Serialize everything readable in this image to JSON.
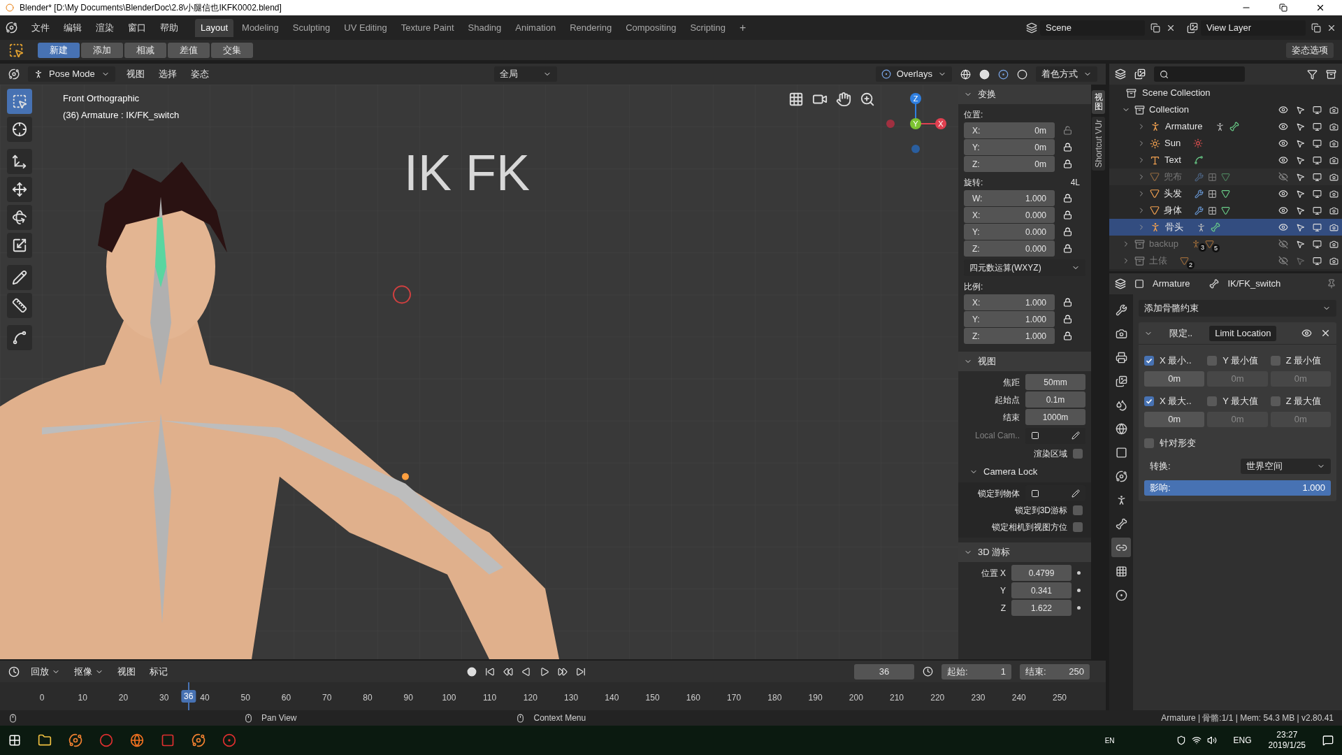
{
  "window": {
    "title": "Blender* [D:\\My Documents\\BlenderDoc\\2.8\\小腿信也IKFK0002.blend]"
  },
  "menu": [
    "文件",
    "编辑",
    "渲染",
    "窗口",
    "帮助"
  ],
  "workspaces": [
    {
      "label": "Layout",
      "selected": true
    },
    {
      "label": "Modeling",
      "selected": false
    },
    {
      "label": "Sculpting",
      "selected": false
    },
    {
      "label": "UV Editing",
      "selected": false
    },
    {
      "label": "Texture Paint",
      "selected": false
    },
    {
      "label": "Shading",
      "selected": false
    },
    {
      "label": "Animation",
      "selected": false
    },
    {
      "label": "Rendering",
      "selected": false
    },
    {
      "label": "Compositing",
      "selected": false
    },
    {
      "label": "Scripting",
      "selected": false
    }
  ],
  "add_workspace": "+",
  "scene": "Scene",
  "view_layer": "View Layer",
  "tool_header": {
    "modes": [
      {
        "label": "新建",
        "selected": true
      },
      {
        "label": "添加",
        "selected": false
      },
      {
        "label": "相减",
        "selected": false
      },
      {
        "label": "差值",
        "selected": false
      },
      {
        "label": "交集",
        "selected": false
      }
    ],
    "options": "姿态选项"
  },
  "viewport_header": {
    "mode": "Pose Mode",
    "menus": [
      "视图",
      "选择",
      "姿态"
    ],
    "orientation": "全局",
    "overlays": "Overlays",
    "shading": "着色方式"
  },
  "viewport": {
    "view_name": "Front Orthographic",
    "object_info": "(36) Armature : IK/FK_switch",
    "scene_text": "IK FK",
    "gizmo": [
      "Z",
      "Y",
      "X"
    ],
    "tools": [
      {
        "kind": "select",
        "selected": true
      },
      {
        "kind": "cursor",
        "selected": false
      },
      {
        "kind": "transform",
        "selected": false
      },
      {
        "kind": "move",
        "selected": false
      },
      {
        "kind": "rotate",
        "selected": false
      },
      {
        "kind": "scale",
        "selected": false
      },
      {
        "kind": "annotate",
        "selected": false
      },
      {
        "kind": "measure",
        "selected": false
      },
      {
        "kind": "curve",
        "selected": false
      }
    ]
  },
  "n_panel": {
    "tabs": [
      {
        "label": "视图",
        "selected": true
      },
      {
        "label": "Shortcut VUr",
        "selected": false
      }
    ],
    "transform": {
      "title": "变换",
      "expanded": true,
      "location_label": "位置:",
      "location": [
        {
          "axis": "X:",
          "value": "0m",
          "locked": false
        },
        {
          "axis": "Y:",
          "value": "0m",
          "locked": true
        },
        {
          "axis": "Z:",
          "value": "0m",
          "locked": true
        }
      ],
      "rotation_label": "旋转:",
      "rotation_badge": "4L",
      "rotation": [
        {
          "axis": "W:",
          "value": "1.000",
          "locked": true
        },
        {
          "axis": "X:",
          "value": "0.000",
          "locked": true
        },
        {
          "axis": "Y:",
          "value": "0.000",
          "locked": true
        },
        {
          "axis": "Z:",
          "value": "0.000",
          "locked": true
        }
      ],
      "rotation_mode": "四元数运算(WXYZ)",
      "scale_label": "比例:",
      "scale": [
        {
          "axis": "X:",
          "value": "1.000",
          "locked": true
        },
        {
          "axis": "Y:",
          "value": "1.000",
          "locked": true
        },
        {
          "axis": "Z:",
          "value": "1.000",
          "locked": true
        }
      ]
    },
    "view": {
      "title": "视图",
      "expanded": true,
      "fields": [
        {
          "label": "焦距",
          "value": "50mm"
        },
        {
          "label": "起始点",
          "value": "0.1m"
        },
        {
          "label": "结束",
          "value": "1000m"
        }
      ],
      "local_camera": {
        "label": "Local Cam..",
        "disabled": true
      },
      "render_region": {
        "label": "渲染区域",
        "checked": false
      },
      "camera_lock": {
        "title": "Camera Lock",
        "expanded": true,
        "lock_to_object": "锁定到物体",
        "options": [
          {
            "label": "锁定到3D游标",
            "checked": false
          },
          {
            "label": "锁定相机到视图方位",
            "checked": false
          }
        ]
      }
    },
    "cursor": {
      "title": "3D 游标",
      "expanded": true,
      "location_label": "位置",
      "fields": [
        {
          "axis": "X",
          "value": "0.4799"
        },
        {
          "axis": "Y",
          "value": "0.341"
        },
        {
          "axis": "Z",
          "value": "1.622"
        }
      ]
    }
  },
  "outliner": {
    "root": "Scene Collection",
    "items": [
      {
        "name": "Collection",
        "kind": "collection",
        "expanded": true,
        "visible": true,
        "selectable": true,
        "selected": false,
        "disabled": false,
        "children": [
          {
            "name": "Armature",
            "kind": "armature",
            "expanded": false,
            "visible": true,
            "selectable": true,
            "selected": false,
            "disabled": false,
            "extras": [
              {
                "kind": "pose"
              },
              {
                "kind": "bones"
              }
            ]
          },
          {
            "name": "Sun",
            "kind": "light",
            "expanded": false,
            "visible": true,
            "selectable": true,
            "selected": false,
            "disabled": false,
            "extras": [
              {
                "kind": "sun"
              }
            ]
          },
          {
            "name": "Text",
            "kind": "text",
            "expanded": false,
            "visible": true,
            "selectable": true,
            "selected": false,
            "disabled": false,
            "extras": [
              {
                "kind": "curve"
              }
            ]
          },
          {
            "name": "兜布",
            "kind": "mesh",
            "expanded": false,
            "visible": false,
            "selectable": true,
            "selected": false,
            "disabled": true,
            "extras": [
              {
                "kind": "modifier"
              },
              {
                "kind": "vertex-groups"
              },
              {
                "kind": "mesh-data"
              }
            ]
          },
          {
            "name": "头发",
            "kind": "mesh",
            "expanded": false,
            "visible": true,
            "selectable": true,
            "selected": false,
            "disabled": false,
            "extras": [
              {
                "kind": "modifier"
              },
              {
                "kind": "vertex-groups"
              },
              {
                "kind": "mesh-data"
              }
            ]
          },
          {
            "name": "身体",
            "kind": "mesh",
            "expanded": false,
            "visible": true,
            "selectable": true,
            "selected": false,
            "disabled": false,
            "extras": [
              {
                "kind": "modifier"
              },
              {
                "kind": "vertex-groups"
              },
              {
                "kind": "mesh-data"
              }
            ]
          },
          {
            "name": "骨头",
            "kind": "armature",
            "expanded": false,
            "visible": true,
            "selectable": true,
            "selected": true,
            "disabled": false,
            "extras": [
              {
                "kind": "pose"
              },
              {
                "kind": "bones"
              }
            ]
          }
        ]
      },
      {
        "name": "backup",
        "kind": "collection",
        "expanded": false,
        "visible": false,
        "selectable": true,
        "selected": false,
        "disabled": true,
        "extras": [
          {
            "kind": "armature-count",
            "count": "3"
          },
          {
            "kind": "mesh-count",
            "count": "5"
          }
        ]
      },
      {
        "name": "土俵",
        "kind": "collection",
        "expanded": false,
        "visible": false,
        "selectable": false,
        "selected": false,
        "disabled": true,
        "extras": [
          {
            "kind": "mesh-count",
            "count": "2"
          }
        ]
      }
    ]
  },
  "properties": {
    "object": "Armature",
    "bone": "IK/FK_switch",
    "tabs": [
      {
        "kind": "tool",
        "selected": false
      },
      {
        "kind": "render",
        "selected": false
      },
      {
        "kind": "output",
        "selected": false
      },
      {
        "kind": "view-layer",
        "selected": false
      },
      {
        "kind": "scene",
        "selected": false
      },
      {
        "kind": "world",
        "selected": false
      },
      {
        "kind": "object",
        "selected": false
      },
      {
        "kind": "constraints",
        "selected": false
      },
      {
        "kind": "physics",
        "selected": false
      },
      {
        "kind": "bone",
        "selected": false
      },
      {
        "kind": "bone-constraint",
        "selected": true
      },
      {
        "kind": "texture",
        "selected": false
      },
      {
        "kind": "particles",
        "selected": false
      }
    ],
    "add_constraint": "添加骨骼约束",
    "constraint": {
      "expanded": true,
      "name": "限定..",
      "type": "Limit Location",
      "enabled": true,
      "rows": [
        {
          "checks": [
            {
              "label": "X 最小..",
              "checked": true
            },
            {
              "label": "Y 最小值",
              "checked": false
            },
            {
              "label": "Z 最小值",
              "checked": false
            }
          ],
          "values": [
            "0m",
            "0m",
            "0m"
          ]
        },
        {
          "checks": [
            {
              "label": "X 最大..",
              "checked": true
            },
            {
              "label": "Y 最大值",
              "checked": false
            },
            {
              "label": "Z 最大值",
              "checked": false
            }
          ],
          "values": [
            "0m",
            "0m",
            "0m"
          ]
        }
      ],
      "for_transform": {
        "label": "针对形变",
        "checked": false
      },
      "convert_label": "转换:",
      "convert_value": "世界空间",
      "influence": {
        "label": "影响:",
        "value": "1.000",
        "level": 1
      }
    }
  },
  "timeline": {
    "menus": [
      "回放",
      "抠像",
      "视图",
      "标记"
    ],
    "current_frame": "36",
    "start_label": "起始:",
    "start": "1",
    "end_label": "结束:",
    "end": "250",
    "playhead_frame": "36",
    "ruler": [
      "0",
      "10",
      "20",
      "30",
      "40",
      "50",
      "60",
      "70",
      "80",
      "90",
      "100",
      "110",
      "120",
      "130",
      "140",
      "150",
      "160",
      "170",
      "180",
      "190",
      "200",
      "210",
      "220",
      "230",
      "240",
      "250"
    ]
  },
  "status_bar": {
    "hints": [
      "Pan View",
      "Context Menu"
    ],
    "info": "Armature | 骨骼:1/1 | Mem: 54.3 MB | v2.80.41"
  },
  "taskbar": {
    "ime": "EN",
    "language": "ENG",
    "time": "23:27",
    "date": "2019/1/25"
  }
}
